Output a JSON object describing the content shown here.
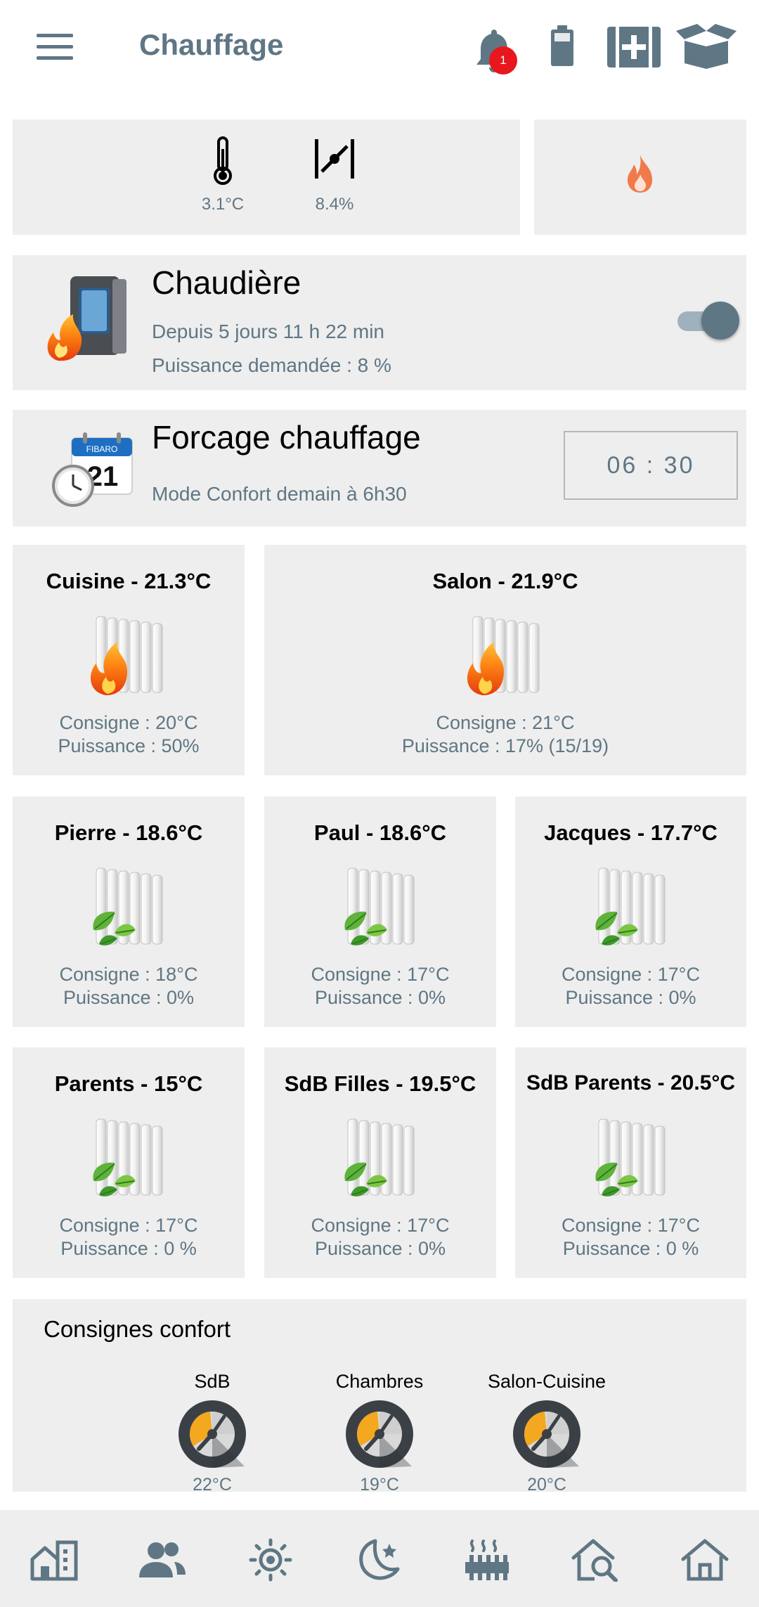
{
  "header": {
    "title": "Chauffage",
    "notification_count": "1"
  },
  "sensors": {
    "temperature": "3.1°C",
    "valve": "8.4%"
  },
  "boiler": {
    "title": "Chaudière",
    "since": "Depuis 5 jours 11 h 22 min",
    "power": "Puissance demandée : 8 %",
    "toggle_on": true
  },
  "forcing": {
    "title": "Forcage chauffage",
    "subtitle": "Mode Confort demain à 6h30",
    "time": "06 : 30"
  },
  "rooms": [
    {
      "name": "Cuisine - 21.3°C",
      "consigne": "Consigne : 20°C",
      "puissance": "Puissance : 50%",
      "state": "heating"
    },
    {
      "name": "Salon - 21.9°C",
      "consigne": "Consigne : 21°C",
      "puissance": "Puissance : 17% (15/19)",
      "state": "heating"
    },
    {
      "name": "Pierre -  18.6°C",
      "consigne": "Consigne : 18°C",
      "puissance": "Puissance : 0%",
      "state": "eco"
    },
    {
      "name": "Paul -  18.6°C",
      "consigne": "Consigne :  17°C",
      "puissance": "Puissance : 0%",
      "state": "eco"
    },
    {
      "name": "Jacques -  17.7°C",
      "consigne": "Consigne : 17°C",
      "puissance": "Puissance : 0%",
      "state": "eco"
    },
    {
      "name": "Parents - 15°C",
      "consigne": "Consigne : 17°C",
      "puissance": "Puissance : 0 %",
      "state": "eco"
    },
    {
      "name": "SdB Filles - 19.5°C",
      "consigne": "Consigne : 17°C",
      "puissance": "Puissance : 0%",
      "state": "eco"
    },
    {
      "name": "SdB Parents - 20.5°C",
      "consigne": "Consigne : 17°C",
      "puissance": "Puissance : 0  %",
      "state": "eco"
    }
  ],
  "comfort": {
    "title": "Consignes confort",
    "items": [
      {
        "label": "SdB",
        "value": "22°C"
      },
      {
        "label": "Chambres",
        "value": "19°C"
      },
      {
        "label": "Salon-Cuisine",
        "value": "20°C"
      }
    ]
  },
  "bottom_nav": [
    {
      "icon": "building-icon",
      "active": false
    },
    {
      "icon": "people-icon",
      "active": false
    },
    {
      "icon": "sun-icon",
      "active": false
    },
    {
      "icon": "moon-stars-icon",
      "active": false
    },
    {
      "icon": "heater-icon",
      "active": true
    },
    {
      "icon": "house-search-icon",
      "active": false
    },
    {
      "icon": "home-icon",
      "active": false
    }
  ],
  "colors": {
    "accent": "#5f7684",
    "tile": "#eeeeee",
    "flame": "#f07a4a",
    "badge": "#e8171d"
  }
}
